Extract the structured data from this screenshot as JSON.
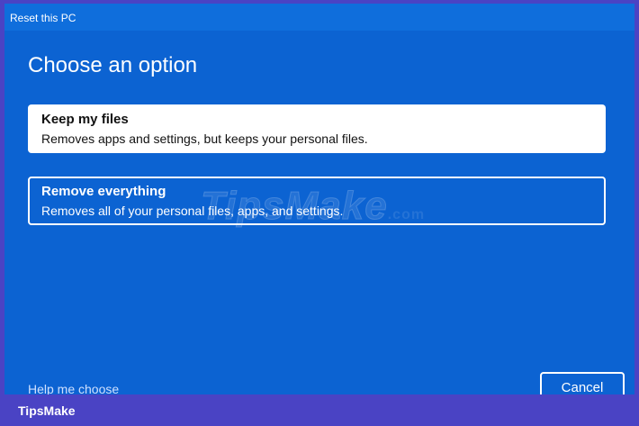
{
  "window": {
    "title": "Reset this PC"
  },
  "main": {
    "heading": "Choose an option",
    "options": [
      {
        "title": "Keep my files",
        "description": "Removes apps and settings, but keeps your personal files."
      },
      {
        "title": "Remove everything",
        "description": "Removes all of your personal files, apps, and settings."
      }
    ]
  },
  "footer": {
    "help_link": "Help me choose",
    "cancel_label": "Cancel"
  },
  "watermark": {
    "text": "TipsMake",
    "suffix": ".com"
  },
  "brand": {
    "label": "TipsMake"
  },
  "colors": {
    "background": "#0c63d2",
    "titlebar": "#0f6edc",
    "frame_border": "#4a43c4",
    "text": "#ffffff",
    "selected_option": "#ffffff"
  }
}
